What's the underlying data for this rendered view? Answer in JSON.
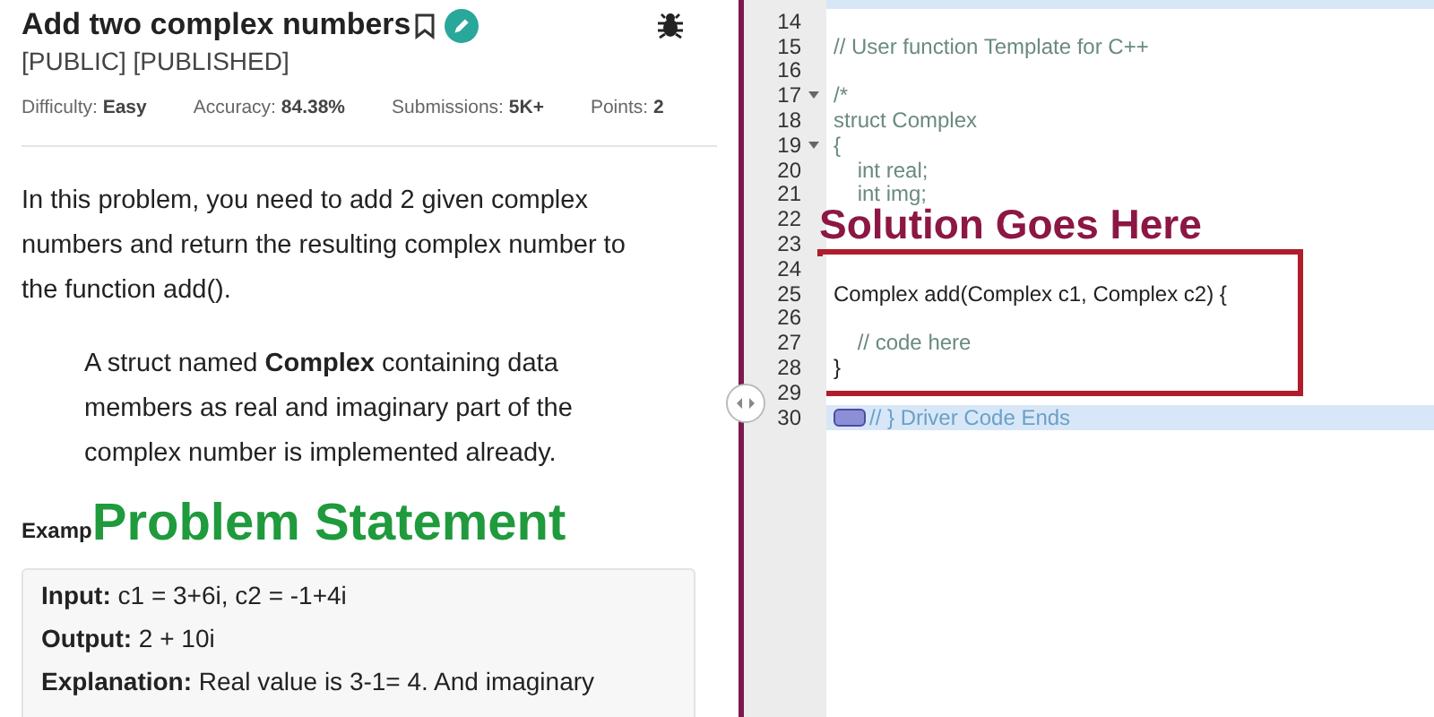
{
  "problem": {
    "title": "Add two complex numbers",
    "tags": "[PUBLIC] [PUBLISHED]",
    "stats": [
      {
        "label": "Difficulty:",
        "value": "Easy"
      },
      {
        "label": "Accuracy:",
        "value": "84.38%"
      },
      {
        "label": "Submissions:",
        "value": "5K+"
      },
      {
        "label": "Points:",
        "value": "2"
      }
    ],
    "description": "In this problem, you need to add 2 given complex numbers and return the resulting complex number to the function add().",
    "note": "A struct named **Complex** containing data members as real and imaginary part of the complex number is implemented already.",
    "example_heading": "Examp",
    "overlay_label": "Problem Statement",
    "example": [
      "**Input:** c1 = 3+6i, c2 = -1+4i",
      "**Output:** 2 + 10i",
      "**Explanation:** Real value is 3-1= 4. And imaginary"
    ]
  },
  "editor": {
    "overlay_label": "Solution Goes Here",
    "lines_above": [
      {
        "number": "14",
        "highlighted": false,
        "foldable": false
      },
      {
        "number": "15",
        "code": "// User function Template for C++",
        "kind": "comment",
        "highlighted": false,
        "foldable": false
      },
      {
        "number": "16",
        "highlighted": false,
        "foldable": false
      },
      {
        "number": "17",
        "code": "/*",
        "kind": "comment",
        "highlighted": false,
        "foldable": true
      },
      {
        "number": "18",
        "code": "struct Complex",
        "kind": "comment",
        "highlighted": false,
        "foldable": false
      },
      {
        "number": "19",
        "code": "{",
        "kind": "comment",
        "highlighted": false,
        "foldable": true
      },
      {
        "number": "20",
        "code": "    int real;",
        "kind": "comment",
        "highlighted": false,
        "foldable": false
      },
      {
        "number": "21",
        "code": "    int img;",
        "kind": "comment",
        "highlighted": false,
        "foldable": false
      },
      {
        "number": "22",
        "highlighted": false,
        "foldable": false
      },
      {
        "number": "23",
        "highlighted": false,
        "foldable": false
      }
    ],
    "solution_lines": [
      {
        "number": "24",
        "highlighted": false,
        "foldable": false
      },
      {
        "number": "25",
        "code": "Complex add(Complex c1, Complex c2) {",
        "kind": "code",
        "highlighted": false,
        "foldable": false
      },
      {
        "number": "26",
        "highlighted": false,
        "foldable": false
      },
      {
        "number": "27",
        "code": "    // code here",
        "kind": "comment",
        "highlighted": false,
        "foldable": false
      },
      {
        "number": "28",
        "code": "}",
        "kind": "code",
        "highlighted": false,
        "foldable": false
      }
    ],
    "lines_below": [
      {
        "number": "29",
        "highlighted": false,
        "foldable": false
      },
      {
        "number": "30",
        "code": "// } Driver Code Ends",
        "kind": "comment",
        "highlighted": true,
        "foldable": false
      }
    ]
  }
}
